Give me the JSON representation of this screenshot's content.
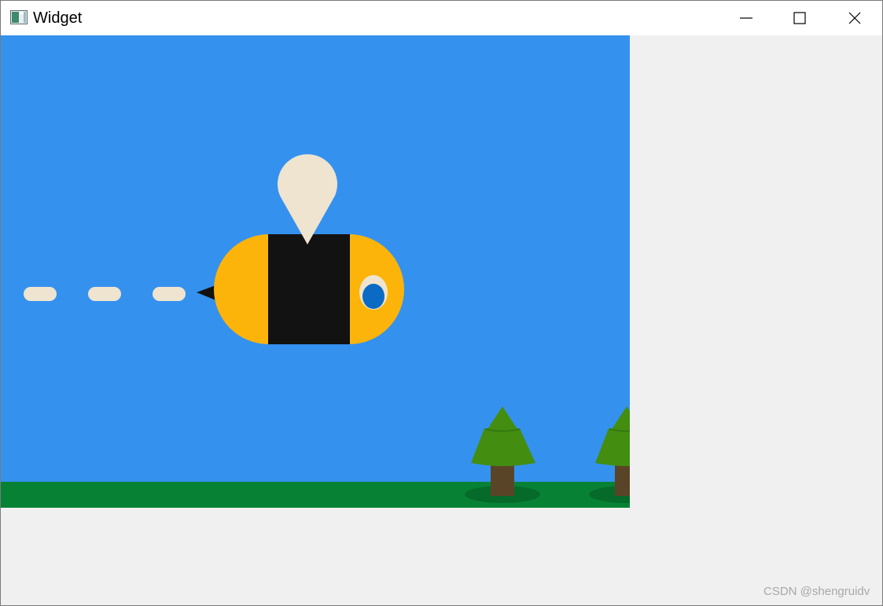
{
  "window": {
    "title": "Widget",
    "icon": "app-window-icon",
    "controls": {
      "minimize": "minimize-icon",
      "maximize": "maximize-icon",
      "close": "close-icon"
    }
  },
  "scene": {
    "sky_color": "#3591ee",
    "ground_color": "#078235",
    "bee": {
      "body_color": "#fcb40a",
      "stripe_color": "#121212",
      "wing_color": "#efe4cf",
      "eye_color": "#0b6bc4"
    },
    "trail_color": "#efe4cf",
    "tree_colors": {
      "foliage": "#438e11",
      "trunk": "#5a4427",
      "shadow": "#066a2a"
    }
  },
  "watermark": {
    "text": "CSDN @shengruidv"
  }
}
